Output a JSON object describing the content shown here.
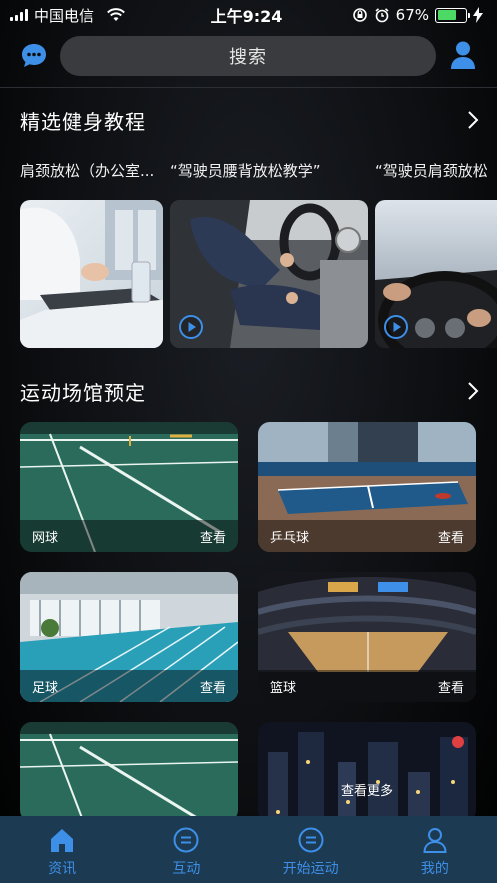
{
  "status_bar": {
    "carrier": "中国电信",
    "time": "上午9:24",
    "battery_percent": "67%",
    "battery_level": 0.67
  },
  "header": {
    "search_label": "搜索"
  },
  "tutorials": {
    "title": "精选健身教程",
    "items": [
      {
        "title": "肩颈放松（办公室..."
      },
      {
        "title": "“驾驶员腰背放松教学”"
      },
      {
        "title": "“驾驶员肩颈放松"
      }
    ]
  },
  "venues": {
    "title": "运动场馆预定",
    "view_label": "查看",
    "items": [
      {
        "name": "网球"
      },
      {
        "name": "乒乓球"
      },
      {
        "name": "足球"
      },
      {
        "name": "篮球"
      }
    ],
    "more_label": "查看更多"
  },
  "tab_bar": {
    "items": [
      {
        "label": "资讯",
        "icon": "home-icon"
      },
      {
        "label": "互动",
        "icon": "chat-icon"
      },
      {
        "label": "开始运动",
        "icon": "chat-icon"
      },
      {
        "label": "我的",
        "icon": "user-icon"
      }
    ]
  },
  "colors": {
    "accent": "#3d8fe8",
    "tab_bar_bg": "#1c3a52",
    "search_bg": "#3a3b3e"
  }
}
